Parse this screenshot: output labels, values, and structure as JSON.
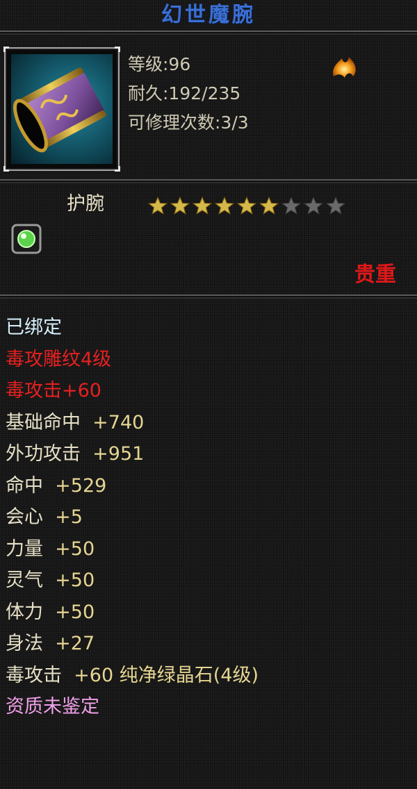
{
  "item": {
    "name": "幻世魔腕",
    "level": "等级:96",
    "durability": "耐久:192/235",
    "repairs": "可修理次数:3/3",
    "icon": "purple-bracer-icon",
    "element_icon": "fire-element-icon",
    "type": "护腕",
    "stars": {
      "filled": 6,
      "total": 9
    },
    "gem_slot_icon": "green-gem-icon",
    "rarity": "贵重"
  },
  "attributes": [
    {
      "key": "已绑定",
      "value": "",
      "color": "#d8f2ff"
    },
    {
      "key": "毒攻雕纹4级",
      "value": "",
      "color": "#e62020"
    },
    {
      "key": "毒攻击+60",
      "value": "",
      "color": "#e62020"
    },
    {
      "key": "基础命中",
      "value": "+740",
      "color": "#e6d692"
    },
    {
      "key": "外功攻击",
      "value": "+951",
      "color": "#e6d692"
    },
    {
      "key": "命中",
      "value": "+529",
      "color": "#e6d692"
    },
    {
      "key": "会心",
      "value": "+5",
      "color": "#e6d692"
    },
    {
      "key": "力量",
      "value": "+50",
      "color": "#e6d692"
    },
    {
      "key": "灵气",
      "value": "+50",
      "color": "#e6d692"
    },
    {
      "key": "体力",
      "value": "+50",
      "color": "#e6d692"
    },
    {
      "key": "身法",
      "value": "+27",
      "color": "#e6d692"
    },
    {
      "key": "毒攻击",
      "value": "+60 纯净绿晶石(4级)",
      "color": "#e6d692"
    },
    {
      "key": "资质未鉴定",
      "value": "",
      "color": "#f0a0e8"
    }
  ],
  "colors": {
    "title": "#3b6fd4",
    "rarity": "#e01818",
    "star_filled": "#d4b84a",
    "star_empty": "#6a6a6a"
  }
}
